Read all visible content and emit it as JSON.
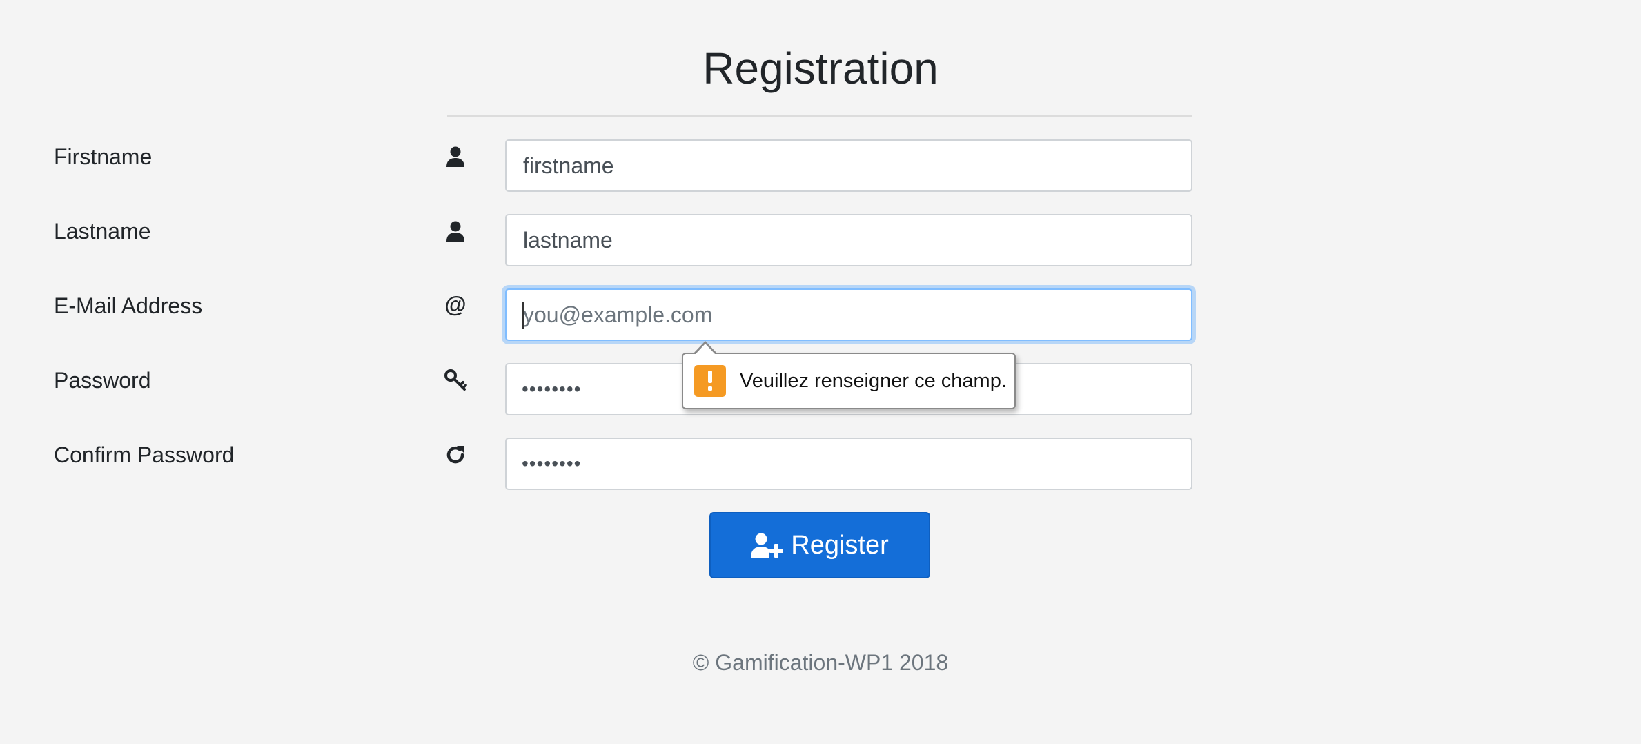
{
  "page": {
    "title": "Registration",
    "footer": "© Gamification-WP1 2018"
  },
  "form": {
    "firstname": {
      "label": "Firstname",
      "icon": "user-icon",
      "value": "firstname"
    },
    "lastname": {
      "label": "Lastname",
      "icon": "user-icon",
      "value": "lastname"
    },
    "email": {
      "label": "E-Mail Address",
      "icon": "at-icon",
      "icon_glyph": "@",
      "placeholder": "you@example.com",
      "value": ""
    },
    "password": {
      "label": "Password",
      "icon": "key-icon",
      "masked_value": "••••••••"
    },
    "confirm_password": {
      "label": "Confirm Password",
      "icon": "refresh-icon",
      "masked_value": "••••••••"
    },
    "submit": {
      "label": "Register",
      "icon": "user-plus-icon"
    }
  },
  "validation_tooltip": {
    "icon": "warning-icon",
    "message": "Veuillez renseigner ce champ."
  },
  "colors": {
    "primary": "#146ed8",
    "warning": "#f59a23",
    "background": "#f4f4f4",
    "focus_ring": "#80bdff"
  }
}
